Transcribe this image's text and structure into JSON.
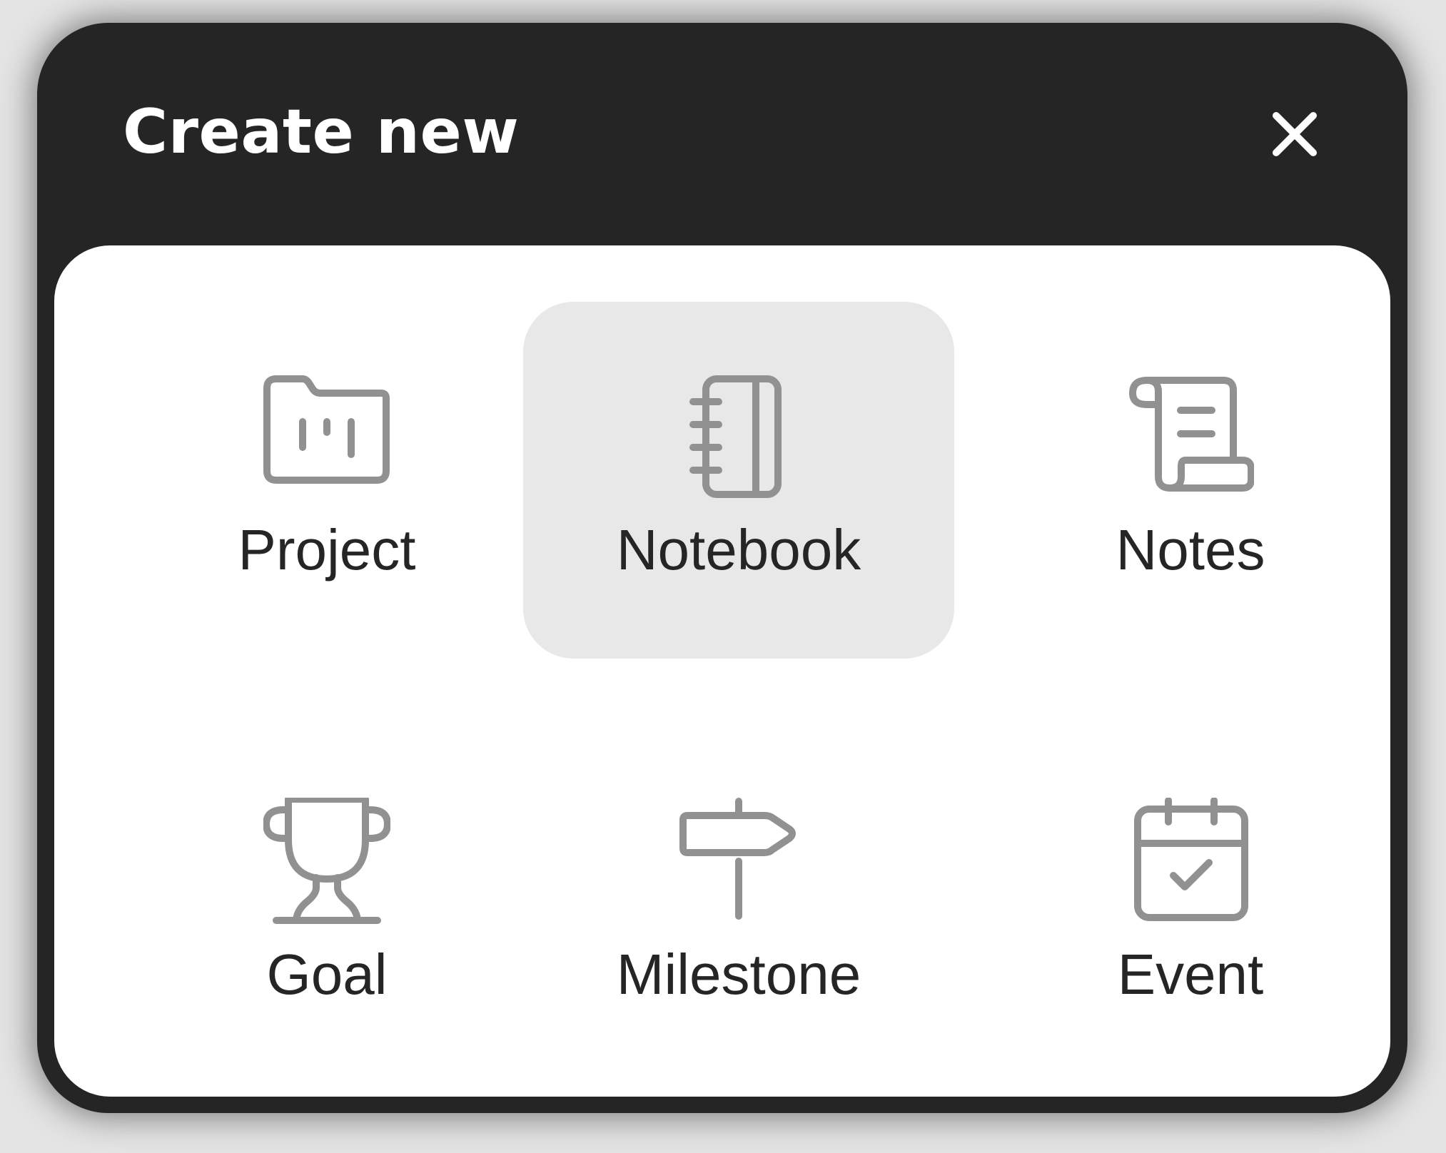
{
  "dialog": {
    "title": "Create new",
    "close_icon": "close-icon",
    "colors": {
      "header_background": "#252525",
      "panel_background": "#ffffff",
      "selected_tile": "#e8e8e8",
      "icon_stroke": "#919191",
      "label_text": "#252525"
    }
  },
  "options": [
    {
      "label": "Project",
      "icon": "folder-chart-icon",
      "selected": false
    },
    {
      "label": "Notebook",
      "icon": "notebook-icon",
      "selected": true
    },
    {
      "label": "Notes",
      "icon": "scroll-icon",
      "selected": false
    },
    {
      "label": "Goal",
      "icon": "trophy-icon",
      "selected": false
    },
    {
      "label": "Milestone",
      "icon": "signpost-icon",
      "selected": false
    },
    {
      "label": "Event",
      "icon": "calendar-check-icon",
      "selected": false
    }
  ]
}
